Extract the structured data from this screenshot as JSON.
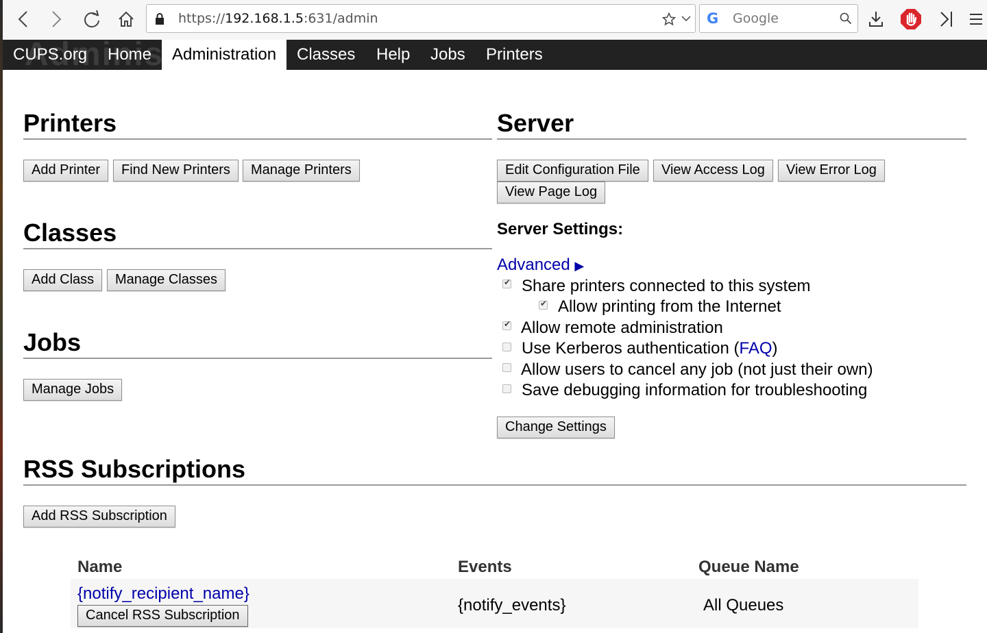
{
  "browser": {
    "url_scheme": "https://",
    "url_host": "192.168.1.5",
    "url_rest": ":631/admin",
    "search_engine": "Google",
    "search_placeholder": "Google"
  },
  "nav": {
    "ghost_text": "Administration",
    "items": [
      "CUPS.org",
      "Home",
      "Administration",
      "Classes",
      "Help",
      "Jobs",
      "Printers"
    ],
    "active": "Administration"
  },
  "printers": {
    "heading": "Printers",
    "buttons": [
      "Add Printer",
      "Find New Printers",
      "Manage Printers"
    ]
  },
  "classes": {
    "heading": "Classes",
    "buttons": [
      "Add Class",
      "Manage Classes"
    ]
  },
  "jobs": {
    "heading": "Jobs",
    "buttons": [
      "Manage Jobs"
    ]
  },
  "server": {
    "heading": "Server",
    "buttons": [
      "Edit Configuration File",
      "View Access Log",
      "View Error Log",
      "View Page Log"
    ],
    "settings_heading": "Server Settings:",
    "advanced_label": "Advanced",
    "advanced_arrow": "▶",
    "options": [
      {
        "label": "Share printers connected to this system",
        "checked": true
      },
      {
        "label": "Allow printing from the Internet",
        "checked": true
      },
      {
        "label": "Allow remote administration",
        "checked": true
      },
      {
        "label": "Use Kerberos authentication (",
        "link": "FAQ",
        "suffix": ")",
        "checked": false
      },
      {
        "label": "Allow users to cancel any job (not just their own)",
        "checked": false
      },
      {
        "label": "Save debugging information for troubleshooting",
        "checked": false
      }
    ],
    "change_button": "Change Settings"
  },
  "rss": {
    "heading": "RSS Subscriptions",
    "add_button": "Add RSS Subscription",
    "columns": [
      "Name",
      "Events",
      "Queue Name"
    ],
    "rows": [
      {
        "name": "{notify_recipient_name}",
        "cancel_button": "Cancel RSS Subscription",
        "events": "{notify_events}",
        "queue": "All Queues"
      }
    ]
  },
  "colors": {
    "nav_bg": "#222222",
    "link": "#0000aa",
    "toolbar_bg": "#f6f6f6"
  }
}
